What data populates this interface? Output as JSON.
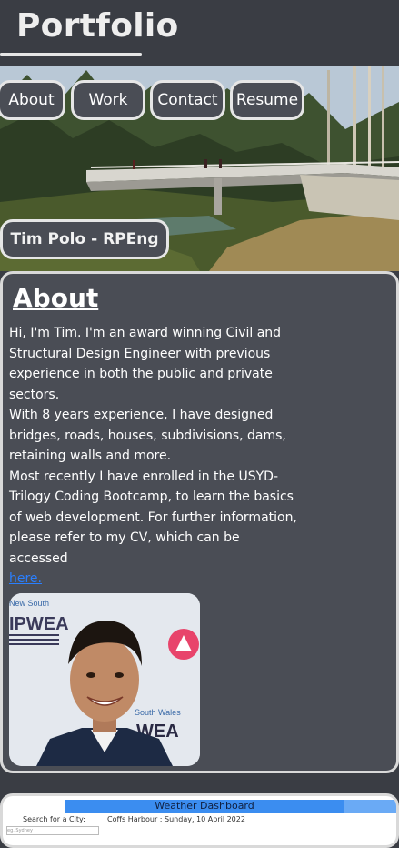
{
  "header": {
    "title": "Portfolio"
  },
  "nav": {
    "items": [
      {
        "label": "About"
      },
      {
        "label": "Work"
      },
      {
        "label": "Contact"
      },
      {
        "label": "Resume"
      }
    ]
  },
  "hero": {
    "name": "Tim Polo - RPEng"
  },
  "about": {
    "heading": "About",
    "paragraphs": [
      "Hi, I'm Tim. I'm an award winning Civil and Structural Design Engineer with previous experience in both the public and private sectors.",
      "With 8 years experience, I have designed bridges, roads, houses, subdivisions, dams, retaining walls and more.",
      "Most recently I have enrolled in the USYD-Trilogy Coding Bootcamp, to learn the basics of web development. For further information, please refer to my CV, which can be accessed"
    ],
    "link_text": "here.",
    "portrait_logo_text": "IPWEA",
    "portrait_logo_text_2": "WEA",
    "portrait_caption_1": "New South",
    "portrait_caption_2": "South Wales"
  },
  "project": {
    "title": "Weather Dashboard",
    "search_label": "Search for a City:",
    "city_line": "Coffs Harbour : Sunday, 10 April 2022",
    "input_placeholder": "eg. Sydney"
  },
  "colors": {
    "background": "#3a3d44",
    "card": "#4a4d55",
    "border": "#e6e6e6",
    "link": "#2a7fff"
  }
}
